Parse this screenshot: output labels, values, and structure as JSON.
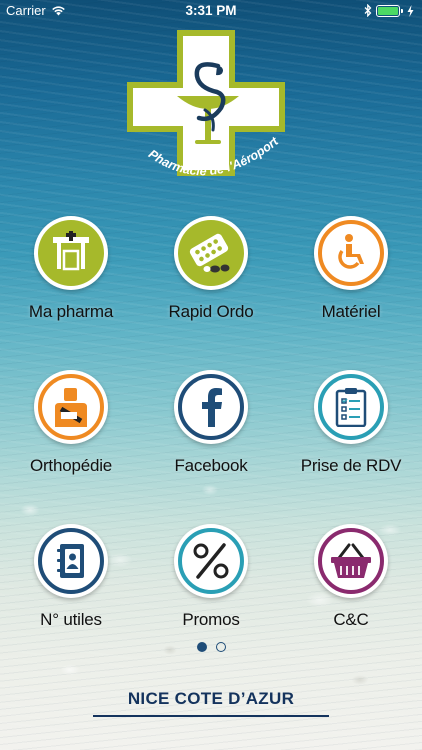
{
  "status_bar": {
    "carrier": "Carrier",
    "time": "3:31 PM"
  },
  "logo": {
    "text": "Pharmacie de l'Aéroport",
    "accent": "#a6b92b"
  },
  "tiles": [
    {
      "label": "Ma pharma",
      "icon": "pharmacy-building-icon",
      "color": "#a6b92b"
    },
    {
      "label": "Rapid Ordo",
      "icon": "pills-icon",
      "color": "#a6b92b"
    },
    {
      "label": "Matériel",
      "icon": "wheelchair-icon",
      "color": "#ef8a22"
    },
    {
      "label": "Orthopédie",
      "icon": "arm-sling-icon",
      "color": "#ef8a22"
    },
    {
      "label": "Facebook",
      "icon": "facebook-icon",
      "color": "#1f4d78"
    },
    {
      "label": "Prise de RDV",
      "icon": "clipboard-checklist-icon",
      "color": "#2a9fb5"
    },
    {
      "label": "N° utiles",
      "icon": "address-book-icon",
      "color": "#1f4d78"
    },
    {
      "label": "Promos",
      "icon": "percent-icon",
      "color": "#2a9fb5"
    },
    {
      "label": "C&C",
      "icon": "shopping-basket-icon",
      "color": "#8a2a6e"
    }
  ],
  "pager": {
    "pages": 2,
    "current": 1
  },
  "footer": {
    "title": "NICE COTE D’AZUR"
  }
}
